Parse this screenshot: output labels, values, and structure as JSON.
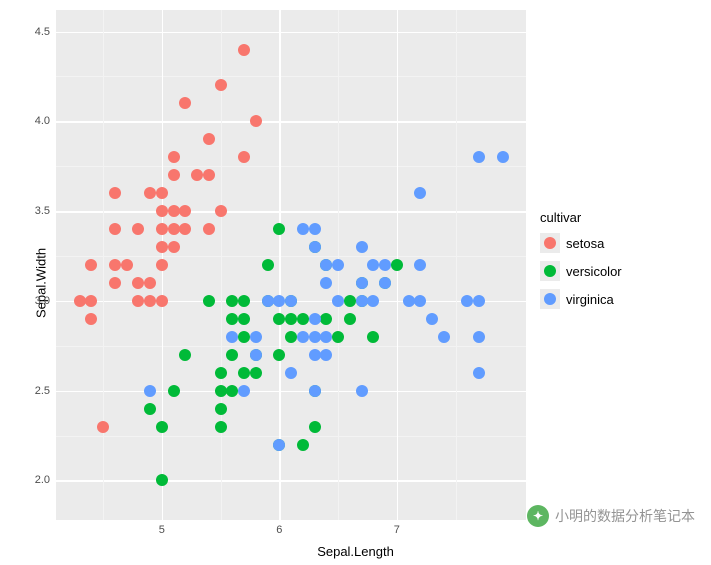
{
  "chart_data": {
    "type": "scatter",
    "xlabel": "Sepal.Length",
    "ylabel": "Sepal.Width",
    "xlim": [
      4.3,
      7.9
    ],
    "ylim": [
      1.9,
      4.5
    ],
    "x_ticks": [
      5,
      6,
      7
    ],
    "y_ticks": [
      2.0,
      2.5,
      3.0,
      3.5,
      4.0,
      4.5
    ],
    "legend_title": "cultivar",
    "legend_position": "right",
    "grid": true,
    "colors": {
      "setosa": "#F8766D",
      "versicolor": "#00BA38",
      "virginica": "#619CFF"
    },
    "series": [
      {
        "name": "setosa",
        "points": [
          {
            "x": 4.3,
            "y": 3.0
          },
          {
            "x": 4.4,
            "y": 2.9
          },
          {
            "x": 4.4,
            "y": 3.0
          },
          {
            "x": 4.4,
            "y": 3.2
          },
          {
            "x": 4.5,
            "y": 2.3
          },
          {
            "x": 4.6,
            "y": 3.1
          },
          {
            "x": 4.6,
            "y": 3.2
          },
          {
            "x": 4.6,
            "y": 3.4
          },
          {
            "x": 4.6,
            "y": 3.6
          },
          {
            "x": 4.7,
            "y": 3.2
          },
          {
            "x": 4.8,
            "y": 3.0
          },
          {
            "x": 4.8,
            "y": 3.1
          },
          {
            "x": 4.8,
            "y": 3.4
          },
          {
            "x": 4.9,
            "y": 3.0
          },
          {
            "x": 4.9,
            "y": 3.1
          },
          {
            "x": 4.9,
            "y": 3.6
          },
          {
            "x": 5.0,
            "y": 3.0
          },
          {
            "x": 5.0,
            "y": 3.2
          },
          {
            "x": 5.0,
            "y": 3.3
          },
          {
            "x": 5.0,
            "y": 3.4
          },
          {
            "x": 5.0,
            "y": 3.5
          },
          {
            "x": 5.0,
            "y": 3.6
          },
          {
            "x": 5.1,
            "y": 3.3
          },
          {
            "x": 5.1,
            "y": 3.4
          },
          {
            "x": 5.1,
            "y": 3.5
          },
          {
            "x": 5.1,
            "y": 3.7
          },
          {
            "x": 5.1,
            "y": 3.8
          },
          {
            "x": 5.2,
            "y": 3.4
          },
          {
            "x": 5.2,
            "y": 3.5
          },
          {
            "x": 5.2,
            "y": 4.1
          },
          {
            "x": 5.3,
            "y": 3.7
          },
          {
            "x": 5.4,
            "y": 3.4
          },
          {
            "x": 5.4,
            "y": 3.7
          },
          {
            "x": 5.4,
            "y": 3.9
          },
          {
            "x": 5.5,
            "y": 3.5
          },
          {
            "x": 5.5,
            "y": 4.2
          },
          {
            "x": 5.7,
            "y": 3.8
          },
          {
            "x": 5.7,
            "y": 4.4
          },
          {
            "x": 5.8,
            "y": 4.0
          }
        ]
      },
      {
        "name": "versicolor",
        "points": [
          {
            "x": 4.9,
            "y": 2.4
          },
          {
            "x": 5.0,
            "y": 2.0
          },
          {
            "x": 5.0,
            "y": 2.3
          },
          {
            "x": 5.1,
            "y": 2.5
          },
          {
            "x": 5.2,
            "y": 2.7
          },
          {
            "x": 5.4,
            "y": 3.0
          },
          {
            "x": 5.5,
            "y": 2.3
          },
          {
            "x": 5.5,
            "y": 2.4
          },
          {
            "x": 5.5,
            "y": 2.5
          },
          {
            "x": 5.5,
            "y": 2.6
          },
          {
            "x": 5.6,
            "y": 2.5
          },
          {
            "x": 5.6,
            "y": 2.7
          },
          {
            "x": 5.6,
            "y": 2.9
          },
          {
            "x": 5.6,
            "y": 3.0
          },
          {
            "x": 5.7,
            "y": 2.6
          },
          {
            "x": 5.7,
            "y": 2.8
          },
          {
            "x": 5.7,
            "y": 2.9
          },
          {
            "x": 5.7,
            "y": 3.0
          },
          {
            "x": 5.8,
            "y": 2.6
          },
          {
            "x": 5.8,
            "y": 2.7
          },
          {
            "x": 5.9,
            "y": 3.0
          },
          {
            "x": 5.9,
            "y": 3.2
          },
          {
            "x": 6.0,
            "y": 2.2
          },
          {
            "x": 6.0,
            "y": 2.7
          },
          {
            "x": 6.0,
            "y": 2.9
          },
          {
            "x": 6.0,
            "y": 3.4
          },
          {
            "x": 6.1,
            "y": 2.8
          },
          {
            "x": 6.1,
            "y": 2.9
          },
          {
            "x": 6.1,
            "y": 3.0
          },
          {
            "x": 6.2,
            "y": 2.2
          },
          {
            "x": 6.2,
            "y": 2.9
          },
          {
            "x": 6.3,
            "y": 2.3
          },
          {
            "x": 6.3,
            "y": 2.5
          },
          {
            "x": 6.3,
            "y": 3.3
          },
          {
            "x": 6.4,
            "y": 2.9
          },
          {
            "x": 6.4,
            "y": 3.2
          },
          {
            "x": 6.5,
            "y": 2.8
          },
          {
            "x": 6.6,
            "y": 2.9
          },
          {
            "x": 6.6,
            "y": 3.0
          },
          {
            "x": 6.7,
            "y": 3.0
          },
          {
            "x": 6.7,
            "y": 3.1
          },
          {
            "x": 6.8,
            "y": 2.8
          },
          {
            "x": 6.9,
            "y": 3.1
          },
          {
            "x": 7.0,
            "y": 3.2
          }
        ]
      },
      {
        "name": "virginica",
        "points": [
          {
            "x": 4.9,
            "y": 2.5
          },
          {
            "x": 5.6,
            "y": 2.8
          },
          {
            "x": 5.7,
            "y": 2.5
          },
          {
            "x": 5.8,
            "y": 2.7
          },
          {
            "x": 5.8,
            "y": 2.8
          },
          {
            "x": 5.9,
            "y": 3.0
          },
          {
            "x": 6.0,
            "y": 2.2
          },
          {
            "x": 6.0,
            "y": 3.0
          },
          {
            "x": 6.1,
            "y": 2.6
          },
          {
            "x": 6.1,
            "y": 3.0
          },
          {
            "x": 6.2,
            "y": 2.8
          },
          {
            "x": 6.2,
            "y": 3.4
          },
          {
            "x": 6.3,
            "y": 2.5
          },
          {
            "x": 6.3,
            "y": 2.7
          },
          {
            "x": 6.3,
            "y": 2.8
          },
          {
            "x": 6.3,
            "y": 2.9
          },
          {
            "x": 6.3,
            "y": 3.3
          },
          {
            "x": 6.3,
            "y": 3.4
          },
          {
            "x": 6.4,
            "y": 2.7
          },
          {
            "x": 6.4,
            "y": 2.8
          },
          {
            "x": 6.4,
            "y": 3.1
          },
          {
            "x": 6.4,
            "y": 3.2
          },
          {
            "x": 6.5,
            "y": 3.0
          },
          {
            "x": 6.5,
            "y": 3.2
          },
          {
            "x": 6.7,
            "y": 2.5
          },
          {
            "x": 6.7,
            "y": 3.0
          },
          {
            "x": 6.7,
            "y": 3.1
          },
          {
            "x": 6.7,
            "y": 3.3
          },
          {
            "x": 6.8,
            "y": 3.0
          },
          {
            "x": 6.8,
            "y": 3.2
          },
          {
            "x": 6.9,
            "y": 3.1
          },
          {
            "x": 6.9,
            "y": 3.2
          },
          {
            "x": 7.1,
            "y": 3.0
          },
          {
            "x": 7.2,
            "y": 3.0
          },
          {
            "x": 7.2,
            "y": 3.2
          },
          {
            "x": 7.2,
            "y": 3.6
          },
          {
            "x": 7.3,
            "y": 2.9
          },
          {
            "x": 7.4,
            "y": 2.8
          },
          {
            "x": 7.6,
            "y": 3.0
          },
          {
            "x": 7.7,
            "y": 2.6
          },
          {
            "x": 7.7,
            "y": 2.8
          },
          {
            "x": 7.7,
            "y": 3.0
          },
          {
            "x": 7.7,
            "y": 3.8
          },
          {
            "x": 7.9,
            "y": 3.8
          }
        ]
      }
    ]
  },
  "watermark": {
    "text": "小明的数据分析笔记本"
  }
}
